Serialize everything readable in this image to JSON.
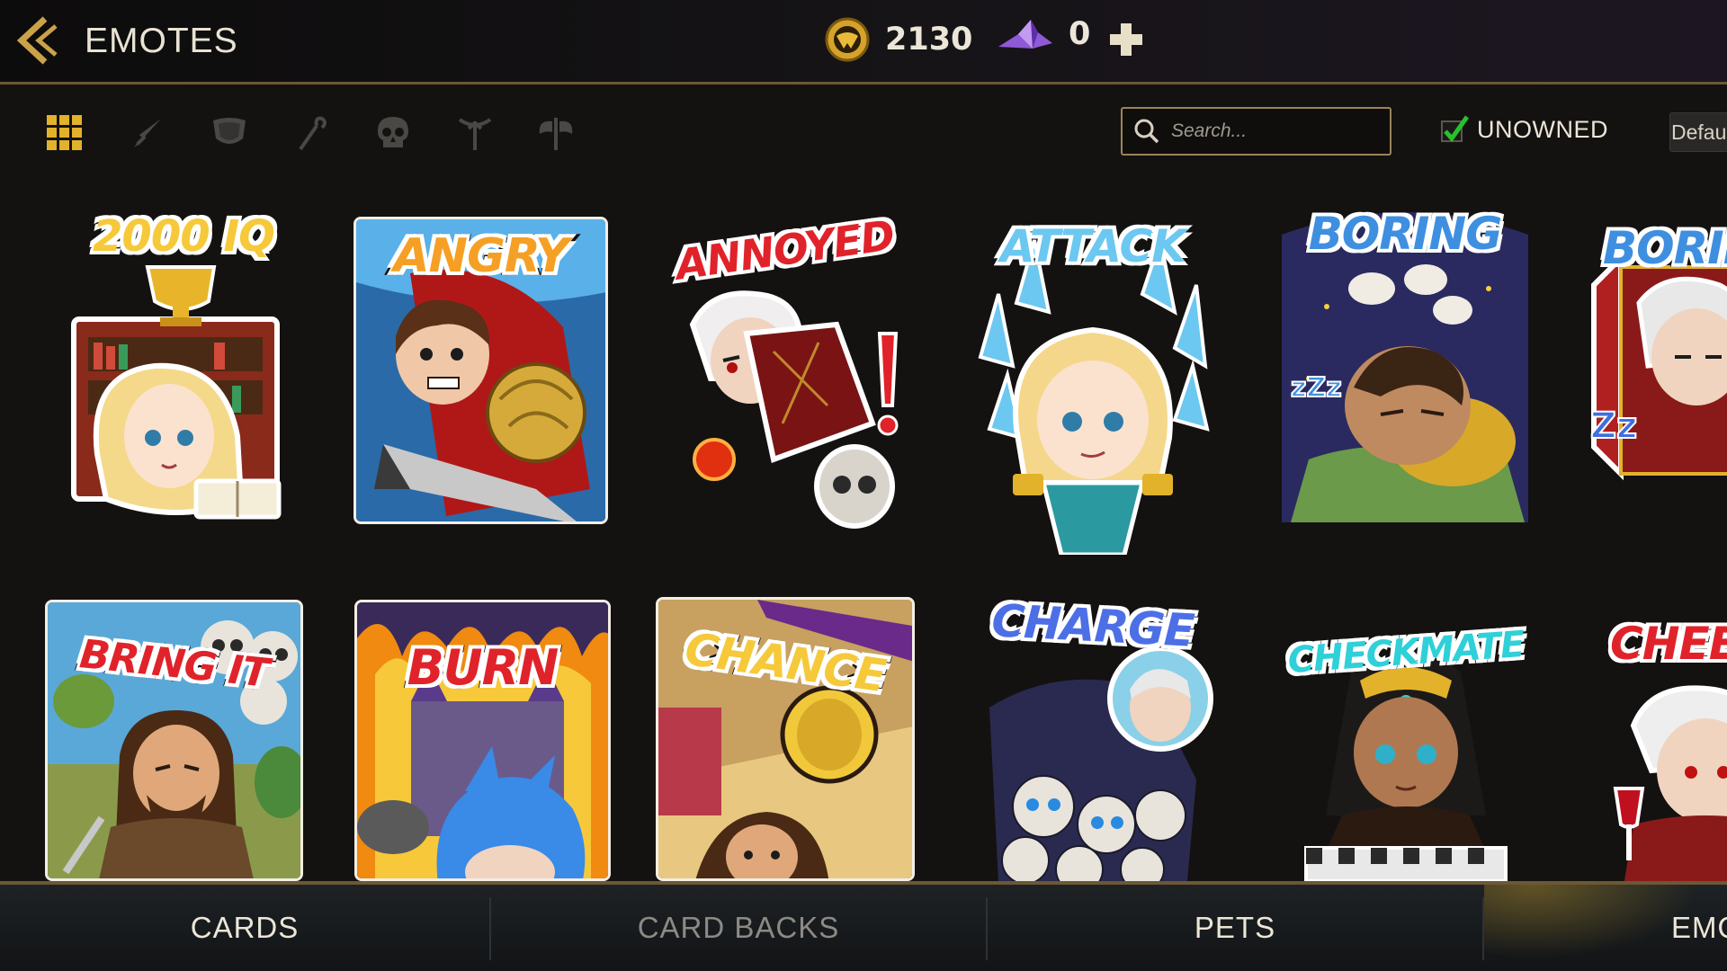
{
  "header": {
    "title": "EMOTES",
    "back_icon": "double-chevron-left-icon",
    "gold": {
      "icon": "gold-coin-icon",
      "value": "2130"
    },
    "gems": {
      "icon": "crystal-icon",
      "value": "0"
    },
    "add_icon": "plus-icon"
  },
  "filters": {
    "categories": [
      {
        "name": "all",
        "icon": "grid-icon",
        "active": true
      },
      {
        "name": "sword",
        "icon": "sword-icon",
        "active": false
      },
      {
        "name": "shield",
        "icon": "shield-icon",
        "active": false
      },
      {
        "name": "staff",
        "icon": "staff-icon",
        "active": false
      },
      {
        "name": "skull",
        "icon": "skull-icon",
        "active": false
      },
      {
        "name": "bow",
        "icon": "bow-icon",
        "active": false
      },
      {
        "name": "axe",
        "icon": "axe-icon",
        "active": false
      }
    ],
    "search_placeholder": "Search...",
    "unowned_label": "UNOWNED",
    "unowned_checked": true,
    "sort_value": "Default"
  },
  "emotes": [
    {
      "label": "2000 IQ",
      "style": "sticker",
      "color": "#f6c93a"
    },
    {
      "label": "ANGRY",
      "style": "card",
      "color": "#f5a025"
    },
    {
      "label": "ANNOYED",
      "style": "sticker",
      "color": "#e0232a"
    },
    {
      "label": "ATTACK",
      "style": "sticker",
      "color": "#6cc8f0"
    },
    {
      "label": "BORING",
      "style": "sticker",
      "color": "#3f8fe0"
    },
    {
      "label": "BORING",
      "style": "sticker",
      "color": "#3f8fe0"
    },
    {
      "label": "BRING IT",
      "style": "card",
      "color": "#e0232a"
    },
    {
      "label": "BURN",
      "style": "card",
      "color": "#e0232a"
    },
    {
      "label": "CHANCE",
      "style": "card",
      "color": "#f6c93a"
    },
    {
      "label": "CHARGE",
      "style": "sticker",
      "color": "#4d6fe6"
    },
    {
      "label": "CHECKMATE",
      "style": "sticker",
      "color": "#2fd0d8"
    },
    {
      "label": "CHEERS",
      "style": "sticker",
      "color": "#e0232a"
    }
  ],
  "tabs": [
    {
      "label": "CARDS",
      "active": false
    },
    {
      "label": "CARD BACKS",
      "active": false
    },
    {
      "label": "PETS",
      "active": false
    },
    {
      "label": "EMOTES",
      "active": true
    }
  ],
  "colors": {
    "accent_gold": "#e2b22a",
    "frame_gold": "#9a8458",
    "check_green": "#27c12c",
    "tab_active": "#ece6d8",
    "tab_inactive": "#8c8a85"
  }
}
